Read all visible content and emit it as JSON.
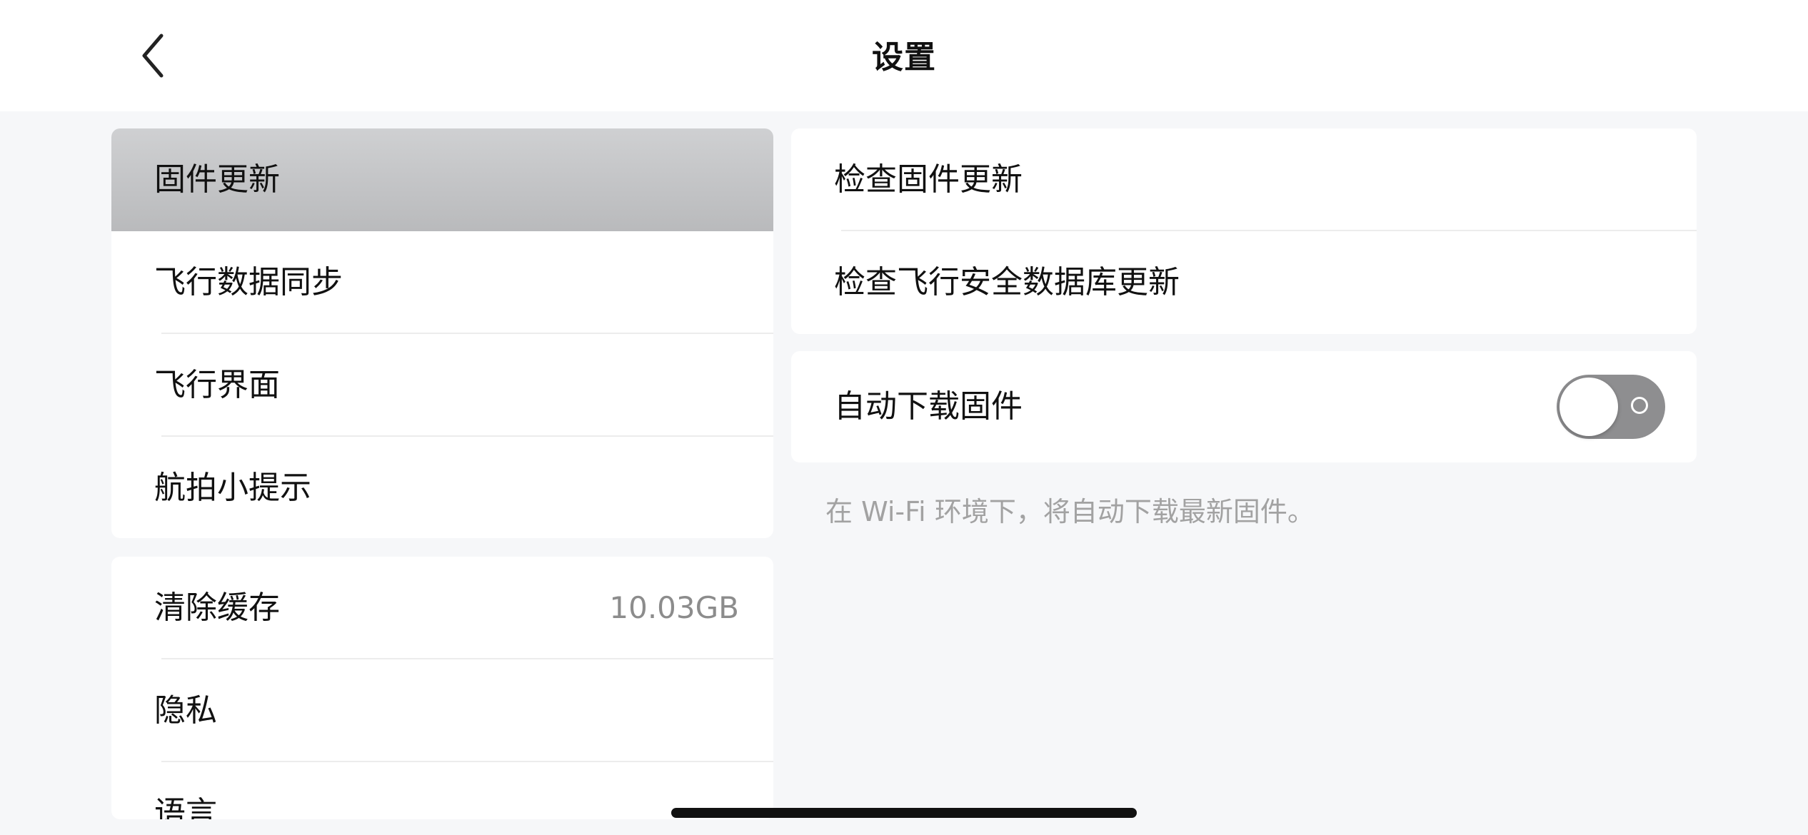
{
  "header": {
    "title": "设置",
    "back_icon": "chevron-left-icon"
  },
  "left": {
    "group1": [
      {
        "label": "固件更新",
        "selected": true
      },
      {
        "label": "飞行数据同步"
      },
      {
        "label": "飞行界面"
      },
      {
        "label": "航拍小提示"
      }
    ],
    "group2": [
      {
        "label": "清除缓存",
        "value": "10.03GB"
      },
      {
        "label": "隐私"
      },
      {
        "label": "语言"
      }
    ]
  },
  "right": {
    "group1": [
      {
        "label": "检查固件更新"
      },
      {
        "label": "检查飞行安全数据库更新"
      }
    ],
    "auto_download": {
      "label": "自动下载固件",
      "toggle_on": false
    },
    "hint": "在 Wi-Fi 环境下，将自动下载最新固件。"
  },
  "colors": {
    "background": "#f6f7f9",
    "card": "#ffffff",
    "selected_row": "#c4c5c7",
    "toggle_off": "#8e8e90",
    "hint_text": "#a2a2a2"
  }
}
